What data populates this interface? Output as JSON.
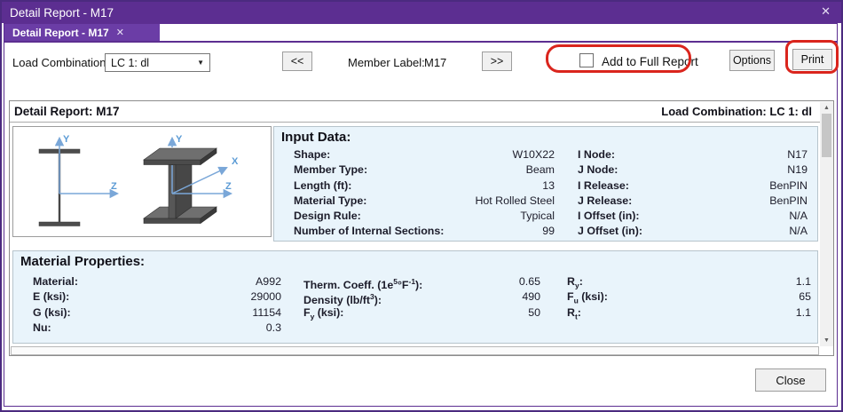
{
  "window": {
    "title": "Detail Report - M17",
    "close_glyph": "✕"
  },
  "tab": {
    "label": "Detail Report - M17",
    "close_glyph": "✕"
  },
  "toolbar": {
    "load_combination_label": "Load Combination:",
    "load_combination_value": "LC 1: dl",
    "prev_button": "<<",
    "member_label": "Member Label:",
    "member_value": "M17",
    "next_button": ">>",
    "add_to_full_report_label": "Add to Full Report",
    "add_to_full_report_checked": false,
    "options_button": "Options",
    "print_button": "Print"
  },
  "report": {
    "title": "Detail Report: M17",
    "load_combination": "Load Combination: LC 1: dl",
    "diagram": {
      "axes_2d": {
        "y": "Y",
        "z": "Z"
      },
      "axes_3d": {
        "x": "X",
        "y": "Y",
        "z": "Z"
      }
    },
    "input_data": {
      "title": "Input Data:",
      "left_rows": [
        {
          "label": [
            [
              "n",
              "Shape:"
            ]
          ],
          "value": "W10X22"
        },
        {
          "label": [
            [
              "n",
              "Member Type:"
            ]
          ],
          "value": "Beam"
        },
        {
          "label": [
            [
              "n",
              "Length (ft):"
            ]
          ],
          "value": "13"
        },
        {
          "label": [
            [
              "n",
              "Material Type:"
            ]
          ],
          "value": "Hot Rolled Steel"
        },
        {
          "label": [
            [
              "n",
              "Design Rule:"
            ]
          ],
          "value": "Typical"
        },
        {
          "label": [
            [
              "n",
              "Number of Internal Sections:"
            ]
          ],
          "value": "99"
        }
      ],
      "right_rows": [
        {
          "label": [
            [
              "n",
              "I Node:"
            ]
          ],
          "value": "N17"
        },
        {
          "label": [
            [
              "n",
              "J Node:"
            ]
          ],
          "value": "N19"
        },
        {
          "label": [
            [
              "n",
              "I Release:"
            ]
          ],
          "value": "BenPIN"
        },
        {
          "label": [
            [
              "n",
              "J Release:"
            ]
          ],
          "value": "BenPIN"
        },
        {
          "label": [
            [
              "n",
              "I Offset (in):"
            ]
          ],
          "value": "N/A"
        },
        {
          "label": [
            [
              "n",
              "J Offset (in):"
            ]
          ],
          "value": "N/A"
        }
      ]
    },
    "material_properties": {
      "title": "Material Properties:",
      "col1_rows": [
        {
          "label": [
            [
              "n",
              "Material:"
            ]
          ],
          "value": "A992"
        },
        {
          "label": [
            [
              "n",
              "E (ksi):"
            ]
          ],
          "value": "29000"
        },
        {
          "label": [
            [
              "n",
              "G (ksi):"
            ]
          ],
          "value": "11154"
        },
        {
          "label": [
            [
              "n",
              "Nu:"
            ]
          ],
          "value": "0.3"
        }
      ],
      "col2_rows": [
        {
          "label": [
            [
              "n",
              "Therm. Coeff. (1e"
            ],
            [
              "sup",
              "5"
            ],
            [
              "n",
              "°F"
            ],
            [
              "sup",
              "-1"
            ],
            [
              "n",
              "):"
            ]
          ],
          "value": "0.65"
        },
        {
          "label": [
            [
              "n",
              "Density (lb/ft"
            ],
            [
              "sup",
              "3"
            ],
            [
              "n",
              "):"
            ]
          ],
          "value": "490"
        },
        {
          "label": [
            [
              "n",
              "F"
            ],
            [
              "sub",
              "y"
            ],
            [
              "n",
              " (ksi):"
            ]
          ],
          "value": "50"
        }
      ],
      "col3_rows": [
        {
          "label": [
            [
              "n",
              "R"
            ],
            [
              "sub",
              "y"
            ],
            [
              "n",
              ":"
            ]
          ],
          "value": "1.1"
        },
        {
          "label": [
            [
              "n",
              "F"
            ],
            [
              "sub",
              "u"
            ],
            [
              "n",
              " (ksi):"
            ]
          ],
          "value": "65"
        },
        {
          "label": [
            [
              "n",
              "R"
            ],
            [
              "sub",
              "t"
            ],
            [
              "n",
              ":"
            ]
          ],
          "value": "1.1"
        }
      ]
    }
  },
  "footer": {
    "close_button": "Close"
  },
  "colors": {
    "titlebar": "#5c2e91",
    "tab": "#6b3da6",
    "annotation_red": "#da251d",
    "box_background": "#e9f4fb",
    "axis_blue": "#7aa7d8"
  }
}
